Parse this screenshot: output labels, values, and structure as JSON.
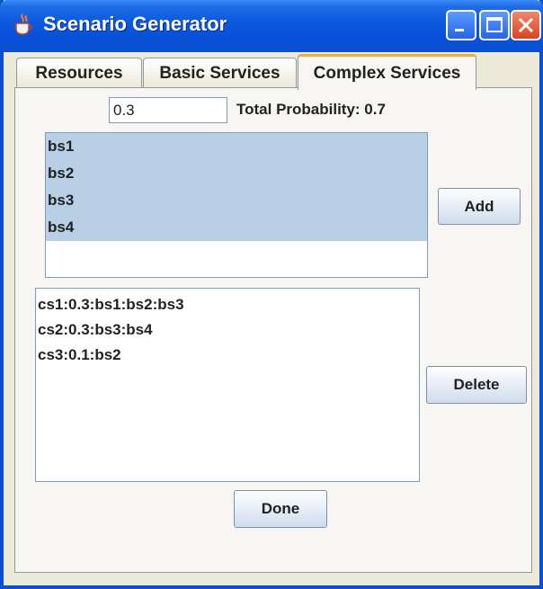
{
  "window": {
    "title": "Scenario Generator",
    "icon": "java-cup-icon"
  },
  "titlebar_buttons": [
    "minimize-icon",
    "maximize-icon",
    "close-icon"
  ],
  "tabs": [
    {
      "label": "Resources",
      "active": false
    },
    {
      "label": "Basic Services",
      "active": false
    },
    {
      "label": "Complex Services",
      "active": true
    }
  ],
  "probability": {
    "value": "0.3",
    "total_label": "Total Probability: 0.7"
  },
  "basic_services": [
    "bs1",
    "bs2",
    "bs3",
    "bs4"
  ],
  "complex_services": [
    "cs1:0.3:bs1:bs2:bs3",
    "cs2:0.3:bs3:bs4",
    "cs3:0.1:bs2"
  ],
  "buttons": {
    "add": "Add",
    "delete": "Delete",
    "done": "Done"
  },
  "colors": {
    "titlebar": "#0a57de",
    "selection": "#b8cfe5",
    "tab_highlight": "#f3ae2d"
  }
}
